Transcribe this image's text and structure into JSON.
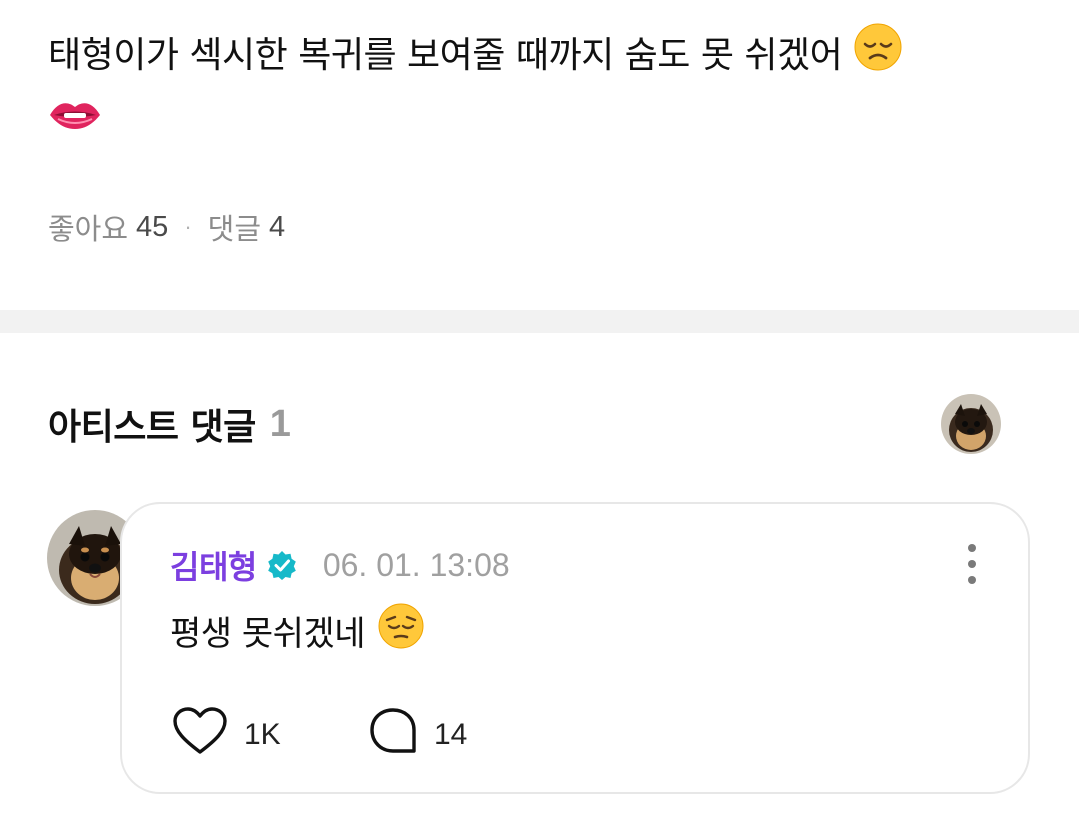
{
  "post": {
    "text": "태형이가 섹시한 복귀를 보여줄 때까지 숨도 못 쉬겠어",
    "emojis": [
      "disappointed-face-emoji",
      "biting-lip-emoji"
    ]
  },
  "stats": {
    "likes_label": "좋아요",
    "likes_count": "45",
    "separator": "·",
    "comments_label": "댓글",
    "comments_count": "4"
  },
  "artist_comments": {
    "title": "아티스트 댓글",
    "count": "1"
  },
  "comment": {
    "author": "김태형",
    "timestamp": "06. 01. 13:08",
    "text": "평생 못쉬겠네",
    "emoji": "pensive-face-emoji",
    "likes": "1K",
    "replies": "14"
  },
  "colors": {
    "author": "#7c3fe0",
    "verified": "#16b9c9",
    "divider": "#f2f2f2",
    "muted": "#8c8c8c"
  }
}
